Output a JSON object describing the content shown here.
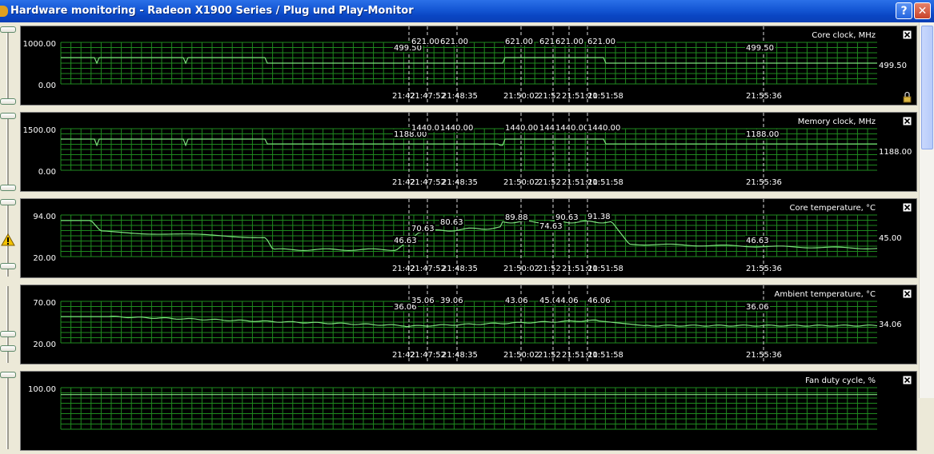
{
  "window": {
    "title": "Hardware monitoring - Radeon X1900 Series  / Plug und Play-Monitor",
    "help_label": "?",
    "close_label": "✕"
  },
  "colors": {
    "plot_bg": "#000000",
    "grid": "#1f8a1f",
    "line": "#7ee07e",
    "text": "#ffffff",
    "marker": "#dcdcdc"
  },
  "icons": {
    "panel_close": "close-icon",
    "warning": "warning-icon",
    "lock": "lock-icon"
  },
  "panels": [
    {
      "title": "Core clock, MHz",
      "y_max_label": "1000.00",
      "y_min_label": "0.00",
      "ylim": [
        0,
        1000
      ],
      "current_value": "499.50",
      "time_labels": [
        "21:42",
        "21:47:52",
        "21:48:35",
        "21:50:02",
        "21:52",
        "21:51:10",
        "21:51:58",
        "21:55:36"
      ],
      "value_labels": [
        "499.50",
        "621.00",
        "621.00",
        "621.00",
        "621",
        "621.00",
        "621.00",
        "499.50"
      ],
      "has_lock_icon": true
    },
    {
      "title": "Memory clock, MHz",
      "y_max_label": "1500.00",
      "y_min_label": "0.00",
      "ylim": [
        0,
        1500
      ],
      "current_value": "1188.00",
      "time_labels": [
        "21:42",
        "21:47:52",
        "21:48:35",
        "21:50:02",
        "21:52",
        "21:51:10",
        "21:51:58",
        "21:55:36"
      ],
      "value_labels": [
        "1188.00",
        "1440.00",
        "1440.00",
        "1440.00",
        "1440",
        "1440.00",
        "1440.00",
        "1188.00"
      ]
    },
    {
      "title": "Core temperature, °C",
      "y_max_label": "94.00",
      "y_min_label": "20.00",
      "ylim": [
        20,
        94
      ],
      "current_value": "45.00",
      "time_labels": [
        "21:42",
        "21:47:52",
        "21:48:35",
        "21:50:02",
        "21:52",
        "21:51:10",
        "21:51:58",
        "21:55:36"
      ],
      "value_labels": [
        "46.63",
        "70.63",
        "80.63",
        "89.88",
        "74.63",
        "90.63",
        "91.38",
        "46.63"
      ],
      "has_warning_icon": true
    },
    {
      "title": "Ambient temperature, °C",
      "y_max_label": "70.00",
      "y_min_label": "20.00",
      "ylim": [
        20,
        70
      ],
      "current_value": "34.06",
      "time_labels": [
        "21:42",
        "21:47:52",
        "21:48:35",
        "21:50:02",
        "21:52",
        "21:51:10",
        "21:51:58",
        "21:55:36"
      ],
      "value_labels": [
        "36.06",
        "35.06",
        "39.06",
        "43.06",
        "45.06",
        "44.06",
        "46.06",
        "36.06"
      ]
    },
    {
      "title": "Fan duty cycle, %",
      "y_max_label": "100.00",
      "y_min_label": "",
      "ylim": [
        0,
        100
      ],
      "current_value": "",
      "time_labels": [],
      "value_labels": []
    }
  ]
}
